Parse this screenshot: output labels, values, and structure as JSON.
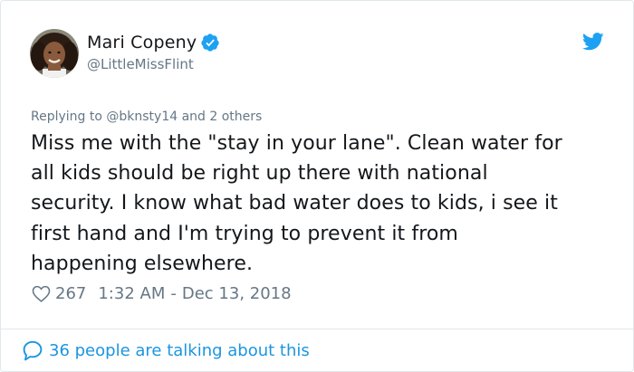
{
  "author": {
    "name": "Mari Copeny",
    "handle": "@LittleMissFlint"
  },
  "reply_context": "Replying to @bknsty14 and 2 others",
  "tweet": {
    "lines": [
      "Miss me with the \"stay in your lane\". Clean water for",
      "all kids should be right up there with national",
      "security. I know what bad water does to kids, i see it",
      "first hand and I'm trying to prevent it from",
      "happening elsewhere."
    ]
  },
  "meta": {
    "likes": "267",
    "time": "1:32 AM",
    "separator": "-",
    "date": "Dec 13, 2018"
  },
  "footer": {
    "talking_label": "36 people are talking about this"
  },
  "colors": {
    "twitter_blue": "#1da1f2",
    "link_blue": "#1b95e0",
    "secondary_text": "#657786",
    "border": "#e1e8ed"
  },
  "icons": {
    "verified": "verified-badge-icon",
    "brand": "twitter-bird-icon",
    "like": "heart-outline-icon",
    "reply": "speech-bubble-icon"
  }
}
